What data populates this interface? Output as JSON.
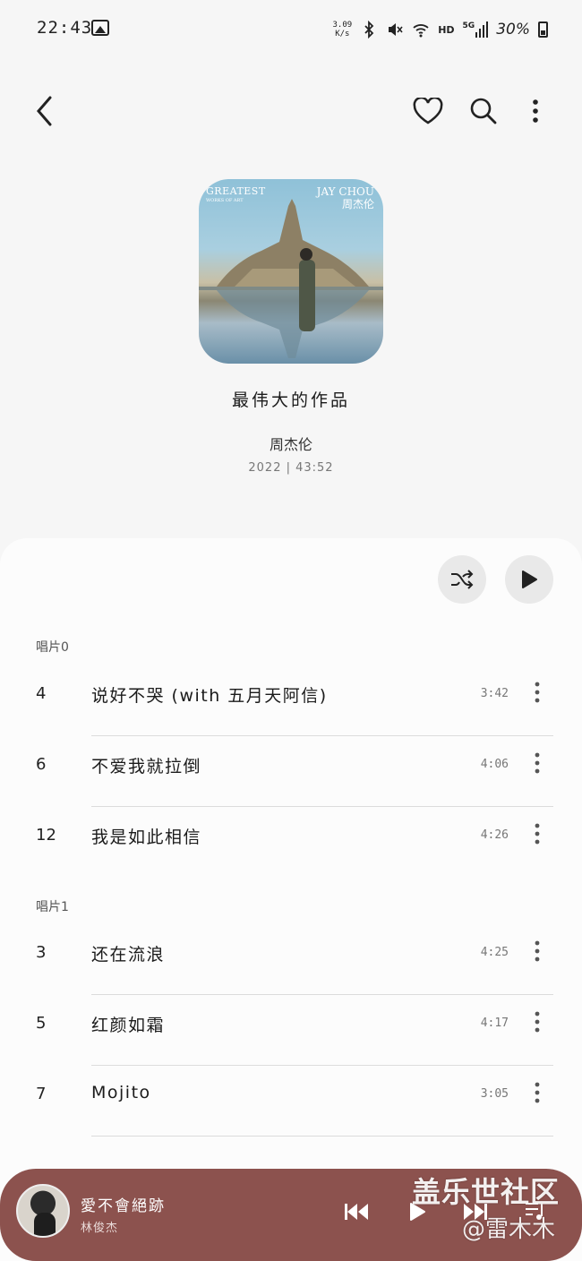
{
  "status_bar": {
    "time": "22:43",
    "net_speed_value": "3.09",
    "net_speed_unit": "K/s",
    "network_label": "HD",
    "signal_label": "5G",
    "battery_percent": "30%"
  },
  "album": {
    "cover_text_left": "GREATEST",
    "cover_text_left_sub": "WORKS OF ART",
    "cover_text_right_en": "JAY CHOU",
    "cover_text_right_cn": "周杰伦",
    "title": "最伟大的作品",
    "artist": "周杰伦",
    "meta": "2022 | 43:52"
  },
  "sections": [
    {
      "label": "唱片0",
      "tracks": [
        {
          "number": "4",
          "title": "说好不哭 (with 五月天阿信)",
          "duration": "3:42"
        },
        {
          "number": "6",
          "title": "不爱我就拉倒",
          "duration": "4:06"
        },
        {
          "number": "12",
          "title": "我是如此相信",
          "duration": "4:26"
        }
      ]
    },
    {
      "label": "唱片1",
      "tracks": [
        {
          "number": "3",
          "title": "还在流浪",
          "duration": "4:25"
        },
        {
          "number": "5",
          "title": "红颜如霜",
          "duration": "4:17"
        },
        {
          "number": "7",
          "title": "Mojito",
          "duration": "3:05"
        }
      ]
    }
  ],
  "mini_player": {
    "title": "愛不會絕跡",
    "artist": "林俊杰"
  },
  "watermark": {
    "line1": "盖乐世社区",
    "line2": "@雷木木"
  },
  "colors": {
    "mini_player_bg": "#8c524e",
    "panel_bg": "#fcfcfc",
    "page_bg": "#f6f6f6"
  },
  "icons": [
    "back-arrow-icon",
    "heart-icon",
    "search-icon",
    "more-vertical-icon",
    "shuffle-icon",
    "play-icon",
    "skip-previous-icon",
    "skip-next-icon",
    "queue-music-icon"
  ]
}
